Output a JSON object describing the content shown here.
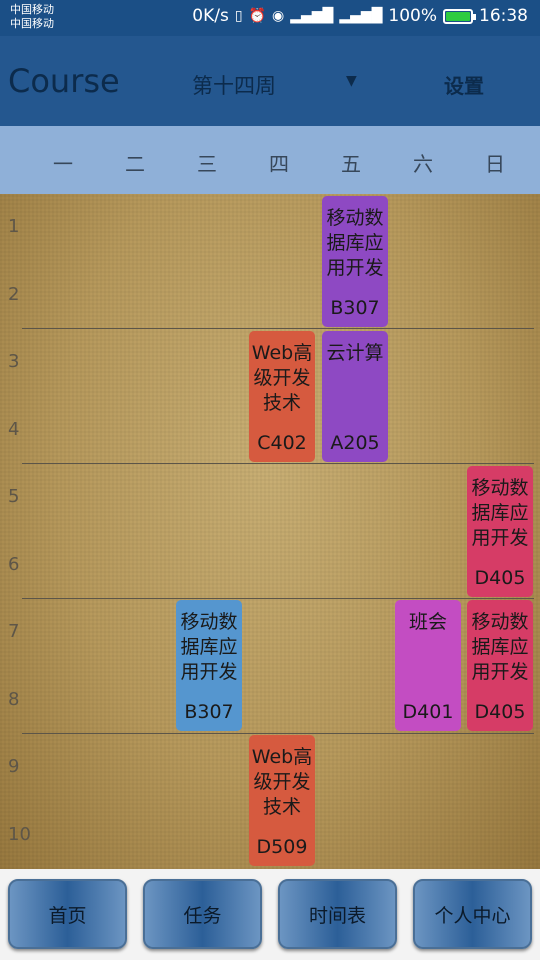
{
  "status_bar": {
    "carrier1": "中国移动",
    "carrier2": "中国移动",
    "speed": "0K/s",
    "icons": [
      "vibrate-icon",
      "alarm-icon",
      "eye-icon",
      "signal-4g-icon",
      "signal-2g-icon"
    ],
    "battery": "100%",
    "battery_level": 1.0,
    "time": "16:38"
  },
  "app_bar": {
    "title": "Course",
    "week": "第十四周",
    "settings": "设置"
  },
  "days": [
    "一",
    "二",
    "三",
    "四",
    "五",
    "六",
    "日"
  ],
  "slots": [
    "1",
    "2",
    "3",
    "4",
    "5",
    "6",
    "7",
    "8",
    "9",
    "10"
  ],
  "courses": [
    {
      "name": "移动数据库应用开发",
      "room": "B307",
      "day": 5,
      "start": 1,
      "span": 2,
      "color": "#8e49c3"
    },
    {
      "name": "Web高级开发技术",
      "room": "C402",
      "day": 4,
      "start": 3,
      "span": 2,
      "color": "#d65a3f"
    },
    {
      "name": "云计算",
      "room": "A205",
      "day": 5,
      "start": 3,
      "span": 2,
      "color": "#8e49c3"
    },
    {
      "name": "移动数据库应用开发",
      "room": "D405",
      "day": 7,
      "start": 5,
      "span": 2,
      "color": "#d63c66"
    },
    {
      "name": "移动数据库应用开发",
      "room": "B307",
      "day": 3,
      "start": 7,
      "span": 2,
      "color": "#5596cf"
    },
    {
      "name": "班会",
      "room": "D401",
      "day": 6,
      "start": 7,
      "span": 2,
      "color": "#c34dc2"
    },
    {
      "name": "移动数据库应用开发",
      "room": "D405",
      "day": 7,
      "start": 7,
      "span": 2,
      "color": "#d63c66"
    },
    {
      "name": "Web高级开发技术",
      "room": "D509",
      "day": 4,
      "start": 9,
      "span": 2,
      "color": "#d65a3f"
    }
  ],
  "nav": [
    "首页",
    "任务",
    "时间表",
    "个人中心"
  ]
}
